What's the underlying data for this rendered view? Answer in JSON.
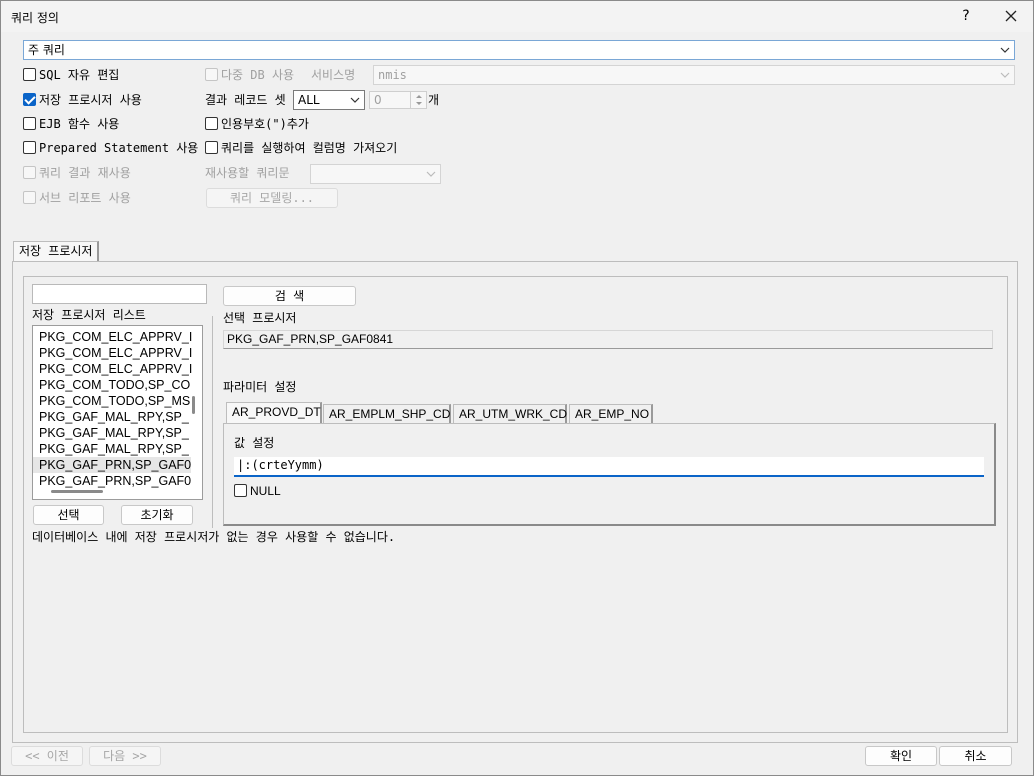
{
  "window": {
    "title": "쿼리 정의",
    "help": "?",
    "close": "✕"
  },
  "main_query": {
    "value": "주 쿼리"
  },
  "options": {
    "sql_free_edit": {
      "label": "SQL 자유 편집",
      "checked": false
    },
    "stored_proc": {
      "label": "저장 프로시저 사용",
      "checked": true
    },
    "ejb": {
      "label": "EJB 함수 사용",
      "checked": false
    },
    "prepared": {
      "label": "Prepared Statement 사용",
      "checked": false
    },
    "reuse_result": {
      "label": "쿼리 결과 재사용",
      "checked": false
    },
    "sub_report": {
      "label": "서브 리포트 사용",
      "checked": false
    },
    "multi_db": {
      "label": "다중 DB 사용",
      "checked": false
    },
    "service_name_label": "서비스명",
    "service_name_value": "nmis",
    "result_set_label": "결과 레코드 셋",
    "result_set_value": "ALL",
    "count_value": "0",
    "count_unit": "개",
    "quote": {
      "label": "인용부호(\")추가",
      "checked": false
    },
    "fetch_columns": {
      "label": "쿼리를 실행하여 컬럼명 가져오기",
      "checked": false
    },
    "reuse_query_label": "재사용할 쿼리문",
    "modeling_button": "쿼리 모델링..."
  },
  "tab_label": "저장 프로시저",
  "proc_panel": {
    "search_input": "",
    "search_button": "검  색",
    "list_label": "저장 프로시저 리스트",
    "list_items": [
      "PKG_COM_ELC_APPRV_I",
      "PKG_COM_ELC_APPRV_I",
      "PKG_COM_ELC_APPRV_I",
      "PKG_COM_TODO,SP_CO",
      "PKG_COM_TODO,SP_MS",
      "PKG_GAF_MAL_RPY,SP_",
      "PKG_GAF_MAL_RPY,SP_",
      "PKG_GAF_MAL_RPY,SP_",
      "PKG_GAF_PRN,SP_GAF0",
      "PKG_GAF_PRN,SP_GAF0"
    ],
    "select_button": "선택",
    "reset_button": "초기화",
    "selected_label": "선택 프로시저",
    "selected_value": "PKG_GAF_PRN,SP_GAF0841",
    "param_label": "파라미터 설정",
    "param_tabs": [
      "AR_PROVD_DT",
      "AR_EMPLM_SHP_CD",
      "AR_UTM_WRK_CD",
      "AR_EMP_NO"
    ],
    "value_label": "값 설정",
    "value_input": "|:(crteYymm)",
    "null_label": "NULL",
    "notice": "데이터베이스 내에 저장 프로시저가 없는 경우 사용할 수 없습니다."
  },
  "footer": {
    "prev": "<< 이전",
    "next": "다음 >>",
    "ok": "확인",
    "cancel": "취소"
  }
}
